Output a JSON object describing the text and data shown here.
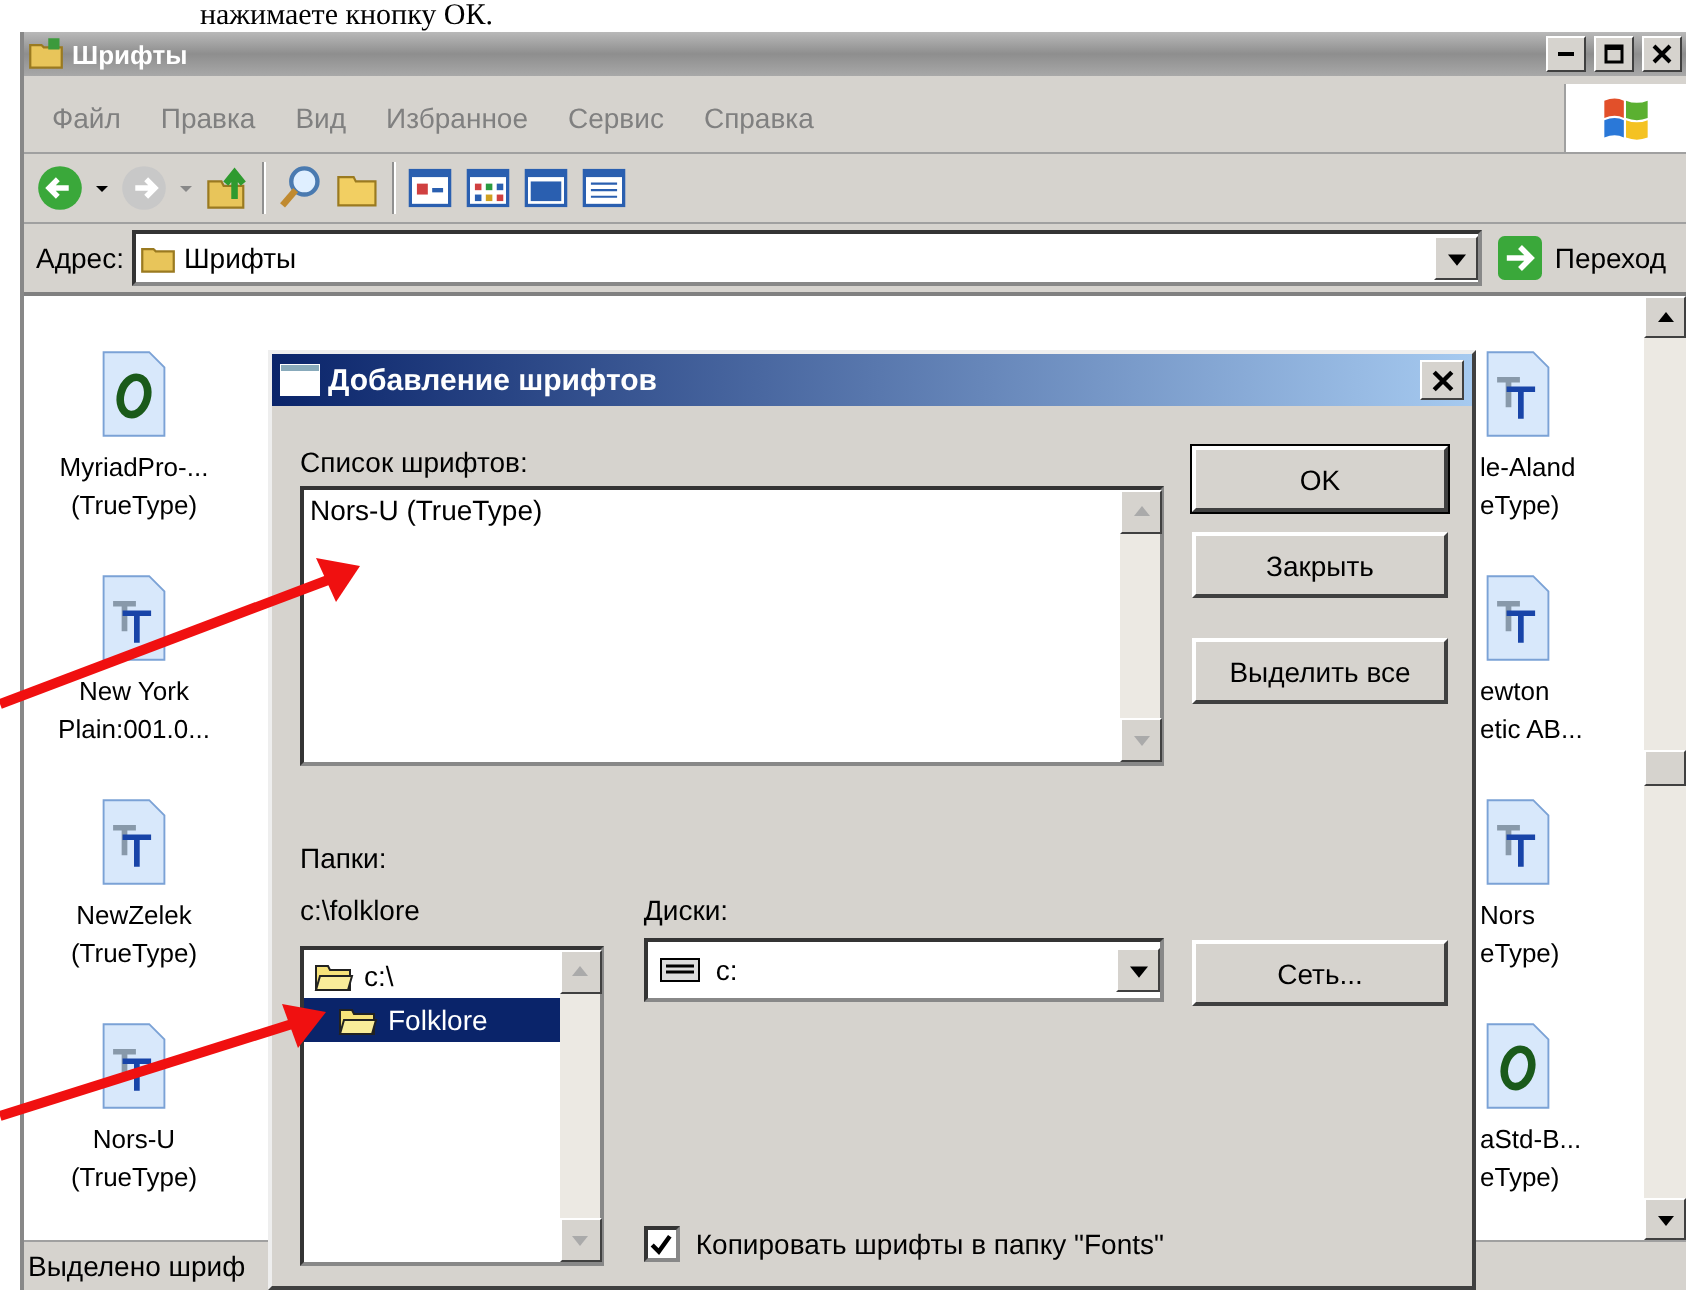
{
  "caption": "нажимаете кнопку ОК.",
  "window": {
    "title": "Шрифты"
  },
  "menu": [
    "Файл",
    "Правка",
    "Вид",
    "Избранное",
    "Сервис",
    "Справка"
  ],
  "address": {
    "label": "Адрес:",
    "value": "Шрифты",
    "go": "Переход"
  },
  "left_icons": [
    {
      "kind": "opentype",
      "name": "MyriadPro-...",
      "type": "(TrueType)"
    },
    {
      "kind": "truetype",
      "name": "New York",
      "type": "Plain:001.0..."
    },
    {
      "kind": "truetype",
      "name": "NewZelek",
      "type": "(TrueType)"
    },
    {
      "kind": "truetype",
      "name": "Nors-U",
      "type": "(TrueType)"
    }
  ],
  "right_icons": [
    {
      "kind": "truetype",
      "name": "le-Aland",
      "type": "eType)"
    },
    {
      "kind": "truetype",
      "name": "ewton",
      "type": "etic AB..."
    },
    {
      "kind": "truetype",
      "name": "Nors",
      "type": "eType)"
    },
    {
      "kind": "opentype",
      "name": "aStd-B...",
      "type": "eType)"
    }
  ],
  "status_bar": "Выделено шриф",
  "dialog": {
    "title": "Добавление шрифтов",
    "font_list_label": "Список шрифтов:",
    "font_list": [
      "Nors-U (TrueType)"
    ],
    "folders_label": "Папки:",
    "current_path": "c:\\folklore",
    "folders": [
      {
        "name": "c:\\",
        "selected": false
      },
      {
        "name": "Folklore",
        "selected": true
      }
    ],
    "drives_label": "Диски:",
    "drive": "c:",
    "buttons": {
      "ok": "OK",
      "close": "Закрыть",
      "select_all": "Выделить все",
      "network": "Сеть..."
    },
    "copy_checkbox": {
      "label": "Копировать шрифты в папку \"Fonts\"",
      "checked": true
    }
  }
}
